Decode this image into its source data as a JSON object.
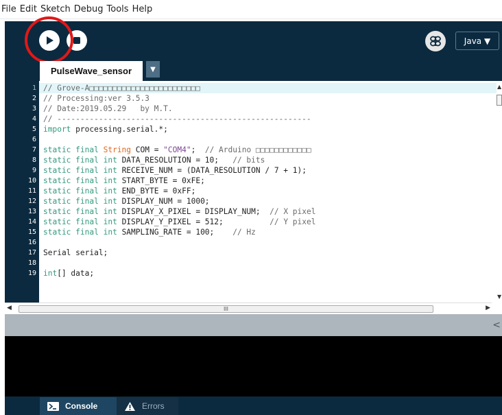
{
  "menu": [
    "File",
    "Edit",
    "Sketch",
    "Debug",
    "Tools",
    "Help"
  ],
  "toolbar": {
    "run_icon": "play-icon",
    "stop_icon": "stop-icon",
    "mode_icon": "debug-butterfly-icon",
    "mode_label": "Java ▼"
  },
  "tabs": [
    {
      "label": "PulseWave_sensor"
    }
  ],
  "tab_menu": "▼",
  "editor": {
    "current_line": 1,
    "line_numbers": [
      "1",
      "2",
      "3",
      "4",
      "5",
      "6",
      "7",
      "8",
      "9",
      "10",
      "11",
      "12",
      "13",
      "14",
      "15",
      "16",
      "17",
      "18",
      "19"
    ],
    "lines": [
      "// Grove-A□□□□□□□□□□□□□□□□□□□□□□□□",
      "// Processing:ver 3.5.3",
      "// Date:2019.05.29   by M.T.",
      "// -------------------------------------------------------",
      "import processing.serial.*;",
      "",
      "static final String COM = \"COM4\";  // Arduino □□□□□□□□□□□□",
      "static final int DATA_RESOLUTION = 10;   // bits",
      "static final int RECEIVE_NUM = (DATA_RESOLUTION / 7 + 1);",
      "static final int START_BYTE = 0xFE;",
      "static final int END_BYTE = 0xFF;",
      "static final int DISPLAY_NUM = 1000;",
      "static final int DISPLAY_X_PIXEL = DISPLAY_NUM;  // X pixel",
      "static final int DISPLAY_Y_PIXEL = 512;          // Y pixel",
      "static final int SAMPLING_RATE = 100;    // Hz",
      "",
      "Serial serial;",
      "",
      "int[] data;"
    ],
    "hscroll_grip": "III"
  },
  "footer": {
    "console_label": "Console",
    "errors_label": "Errors"
  },
  "colors": {
    "chrome": "#0c2a3f",
    "keyword": "#33997e",
    "type": "#e2661a",
    "string": "#7d4793",
    "comment": "#6a6a6a",
    "highlight_ring": "#e11818"
  }
}
